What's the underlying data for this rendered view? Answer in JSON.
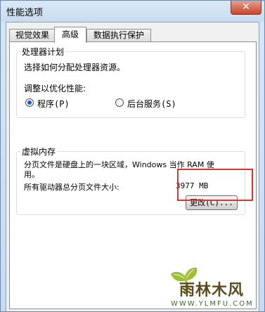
{
  "window": {
    "title": "性能选项",
    "close_label": "✕"
  },
  "tabs": [
    {
      "label": "视觉效果",
      "active": false
    },
    {
      "label": "高级",
      "active": true
    },
    {
      "label": "数据执行保护",
      "active": false
    }
  ],
  "processor_scheduling": {
    "legend": "处理器计划",
    "description": "选择如何分配处理器资源。",
    "adjust_label": "调整以优化性能:",
    "options": [
      {
        "label": "程序(P)",
        "selected": true
      },
      {
        "label": "后台服务(S)",
        "selected": false
      }
    ]
  },
  "virtual_memory": {
    "legend": "虚拟内存",
    "description_line1": "分页文件是硬盘上的一块区域，Windows 当作 RAM 使",
    "description_line2": "用。",
    "total_label": "所有驱动器总分页文件大小:",
    "total_value": "3977 MB",
    "change_button": "更改(C)..."
  },
  "watermark": {
    "brand": "雨林木风",
    "url": "WWW.YLMFU.COM"
  },
  "colors": {
    "highlight": "#d9362f",
    "radio_selected": "#1d5ac9"
  }
}
